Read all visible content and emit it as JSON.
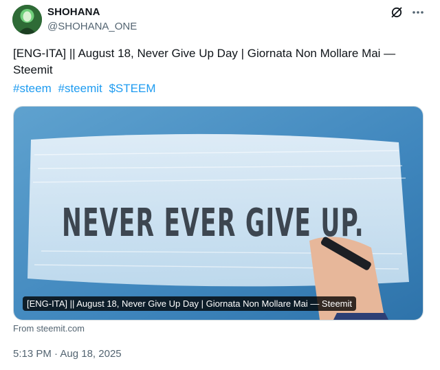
{
  "author": {
    "name": "SHOHANA",
    "handle": "@SHOHANA_ONE"
  },
  "icons": {
    "grok": "grok-icon",
    "more": "more-icon"
  },
  "post": {
    "text": "[ENG-ITA] || August 18, Never Give Up Day  |  Giornata Non Mollare Mai — Steemit",
    "hashtags": [
      "#steem",
      "#steemit",
      "$STEEM"
    ]
  },
  "card": {
    "image_text": "NEVER EVER GIVE UP.",
    "caption": "[ENG-ITA] || August 18, Never Give Up Day | Giornata Non Mollare Mai — Steemit",
    "source": "From steemit.com"
  },
  "meta": {
    "time": "5:13 PM",
    "separator": "·",
    "date": "Aug 18, 2025"
  },
  "colors": {
    "link": "#1d9bf0",
    "muted": "#536471",
    "text": "#0f1419"
  }
}
